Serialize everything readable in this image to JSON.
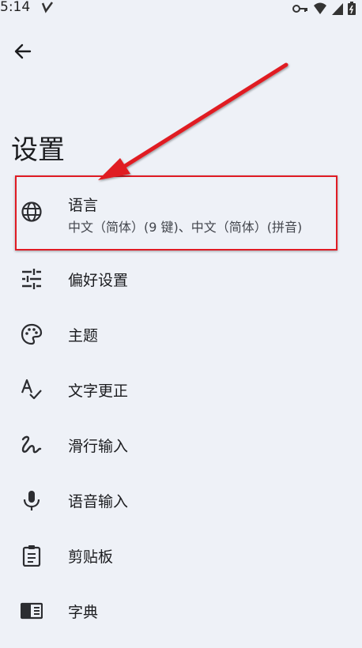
{
  "status_bar": {
    "time": "5:14"
  },
  "page": {
    "title": "设置"
  },
  "menu": [
    {
      "label": "语言",
      "subtitle": "中文（简体）(9 键)、中文（简体）(拼音)",
      "icon": "globe-icon"
    },
    {
      "label": "偏好设置",
      "icon": "tune-icon"
    },
    {
      "label": "主题",
      "icon": "palette-icon"
    },
    {
      "label": "文字更正",
      "icon": "spellcheck-icon"
    },
    {
      "label": "滑行输入",
      "icon": "gesture-icon"
    },
    {
      "label": "语音输入",
      "icon": "mic-icon"
    },
    {
      "label": "剪贴板",
      "icon": "clipboard-icon"
    },
    {
      "label": "字典",
      "icon": "book-icon"
    }
  ],
  "annotation": {
    "color": "#e01b24"
  }
}
